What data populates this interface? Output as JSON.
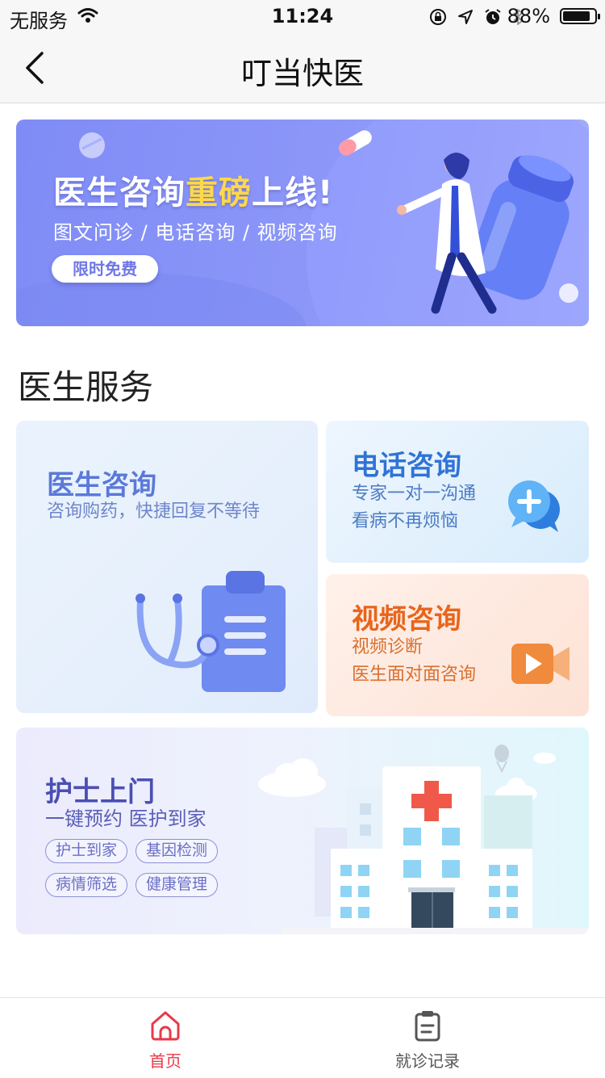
{
  "status_bar": {
    "carrier": "无服务",
    "time": "11:24",
    "battery_pct": "88%",
    "battery_level": 0.88
  },
  "nav": {
    "title": "叮当快医"
  },
  "banner": {
    "headline_pre": "医生咨询",
    "headline_highlight": "重磅",
    "headline_post": "上线!",
    "subtitle": "图文问诊 / 电话咨询 / 视频咨询",
    "button": "限时免费"
  },
  "section": {
    "title": "医生服务"
  },
  "cards": {
    "doctor": {
      "title": "医生咨询",
      "subtitle": "咨询购药，快捷回复不等待"
    },
    "phone": {
      "title": "电话咨询",
      "line1": "专家一对一沟通",
      "line2": "看病不再烦恼"
    },
    "video": {
      "title": "视频咨询",
      "line1": "视频诊断",
      "line2": "医生面对面咨询"
    },
    "nurse": {
      "title": "护士上门",
      "subtitle": "一键预约 医护到家",
      "tags": [
        "护士到家",
        "基因检测",
        "病情筛选",
        "健康管理"
      ]
    }
  },
  "tab_bar": {
    "home": "首页",
    "records": "就诊记录"
  },
  "colors": {
    "accent_red": "#e8394a",
    "banner_purple": "#8d97f8",
    "highlight_yellow": "#ffd84a"
  }
}
